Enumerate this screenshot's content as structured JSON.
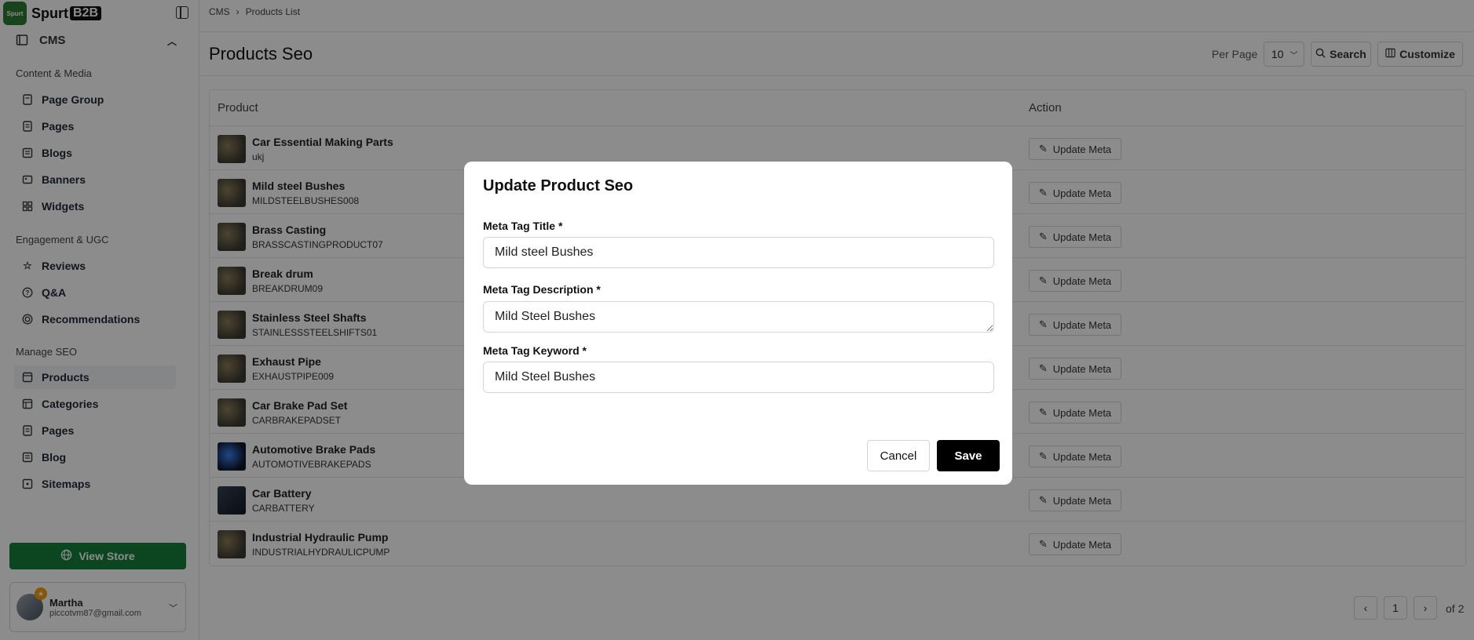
{
  "brand": {
    "name": "Spurt",
    "suffix": "B2B",
    "badge_text": "Spurt"
  },
  "breadcrumb": [
    "CMS",
    "Products List"
  ],
  "sidebar": {
    "cms_label": "CMS",
    "sections": [
      {
        "title": "Content & Media",
        "items": [
          {
            "label": "Page Group",
            "icon": "file-group-icon"
          },
          {
            "label": "Pages",
            "icon": "file-icon"
          },
          {
            "label": "Blogs",
            "icon": "blog-icon"
          },
          {
            "label": "Banners",
            "icon": "banner-icon"
          },
          {
            "label": "Widgets",
            "icon": "widget-icon"
          }
        ]
      },
      {
        "title": "Engagement & UGC",
        "items": [
          {
            "label": "Reviews",
            "icon": "star-icon"
          },
          {
            "label": "Q&A",
            "icon": "question-icon"
          },
          {
            "label": "Recommendations",
            "icon": "target-icon"
          }
        ]
      },
      {
        "title": "Manage SEO",
        "items": [
          {
            "label": "Products",
            "icon": "box-icon",
            "active": true
          },
          {
            "label": "Categories",
            "icon": "categories-icon"
          },
          {
            "label": "Pages",
            "icon": "file-icon"
          },
          {
            "label": "Blog",
            "icon": "blog-icon"
          },
          {
            "label": "Sitemaps",
            "icon": "sitemap-icon"
          }
        ]
      }
    ],
    "view_store": "View Store",
    "user": {
      "name": "Martha",
      "email": "piccotvm87@gmail.com"
    }
  },
  "header": {
    "title": "Products Seo",
    "per_page_label": "Per Page",
    "per_page_value": "10",
    "search_label": "Search",
    "customize_label": "Customize"
  },
  "table": {
    "columns": [
      "Product",
      "Action"
    ],
    "action_label": "Update Meta",
    "rows": [
      {
        "name": "Car Essential Making Parts",
        "sku": "ukj"
      },
      {
        "name": "Mild steel Bushes",
        "sku": "MILDSTEELBUSHES008"
      },
      {
        "name": "Brass Casting",
        "sku": "BRASSCASTINGPRODUCT07"
      },
      {
        "name": "Break drum",
        "sku": "BREAKDRUM09"
      },
      {
        "name": "Stainless Steel Shafts",
        "sku": "STAINLESSSTEELSHIFTS01"
      },
      {
        "name": "Exhaust Pipe",
        "sku": "EXHAUSTPIPE009"
      },
      {
        "name": "Car Brake Pad Set",
        "sku": "CARBRAKEPADSET"
      },
      {
        "name": "Automotive Brake Pads",
        "sku": "AUTOMOTIVEBRAKEPADS"
      },
      {
        "name": "Car Battery",
        "sku": "CARBATTERY"
      },
      {
        "name": "Industrial Hydraulic Pump",
        "sku": "INDUSTRIALHYDRAULICPUMP"
      }
    ]
  },
  "pagination": {
    "current": "1",
    "of_label": "of 2"
  },
  "modal": {
    "title": "Update Product Seo",
    "meta_title_label": "Meta Tag Title *",
    "meta_title_value": "Mild steel Bushes",
    "meta_description_label": "Meta Tag Description *",
    "meta_description_value": "Mild Steel Bushes",
    "meta_keyword_label": "Meta Tag Keyword *",
    "meta_keyword_value": "Mild Steel Bushes",
    "cancel_label": "Cancel",
    "save_label": "Save"
  },
  "colors": {
    "primary_green": "#14803c",
    "save_button": "#000000",
    "overlay": "rgba(0,0,0,0.45)"
  }
}
